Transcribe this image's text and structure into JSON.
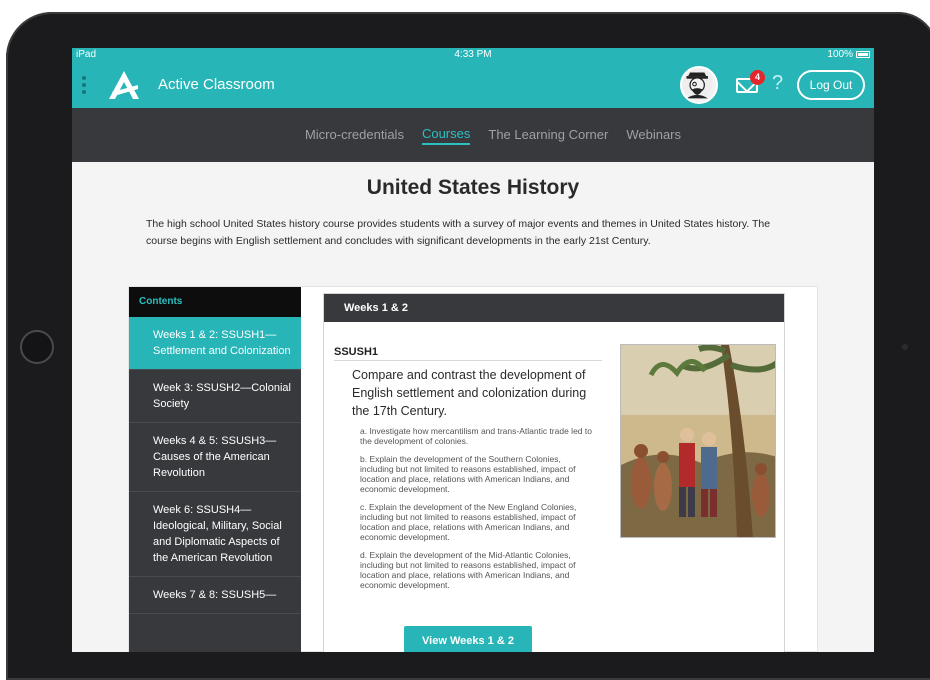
{
  "status_bar": {
    "device": "iPad",
    "time": "4:33 PM",
    "battery": "100%"
  },
  "app": {
    "title": "Active Classroom",
    "mail_badge_count": "4",
    "help_label": "?",
    "logout_label": "Log Out",
    "accent_color": "#27b5b7",
    "dark_color": "#38393d"
  },
  "nav": {
    "items": [
      {
        "label": "Micro-credentials"
      },
      {
        "label": "Courses"
      },
      {
        "label": "The Learning Corner"
      },
      {
        "label": "Webinars"
      }
    ],
    "active": "Courses"
  },
  "page": {
    "title": "United States History",
    "description": "The high school United States history course provides students with a survey of major events and themes in United States history. The course begins with English settlement and concludes with significant developments in the early 21st Century."
  },
  "sidebar": {
    "header": "Contents",
    "items": [
      {
        "label": "Weeks 1 & 2: SSUSH1—Settlement and Colonization"
      },
      {
        "label": "Week 3: SSUSH2—Colonial Society"
      },
      {
        "label": "Weeks 4 & 5: SSUSH3—Causes of the American Revolution"
      },
      {
        "label": "Week 6: SSUSH4—Ideological, Military, Social and Diplomatic Aspects of the American Revolution"
      },
      {
        "label": "Weeks 7 & 8: SSUSH5—"
      }
    ]
  },
  "panel": {
    "header": "Weeks 1 & 2",
    "standard_code": "SSUSH1",
    "standard_text": "Compare and contrast the development of English settlement and colonization during the 17th Century.",
    "substandards": [
      "a. Investigate how mercantilism and trans-Atlantic trade led to the development of colonies.",
      "b. Explain the development of the Southern Colonies, including but not limited to reasons established, impact of location and place, relations with American Indians, and economic development.",
      "c. Explain the development of the New England Colonies, including but not limited to reasons established, impact of location and place, relations with American Indians, and economic development.",
      "d. Explain the development of the Mid-Atlantic Colonies, including but not limited to reasons established, impact of location and place, relations with American Indians, and economic development."
    ],
    "button_label": "View Weeks 1 & 2"
  }
}
